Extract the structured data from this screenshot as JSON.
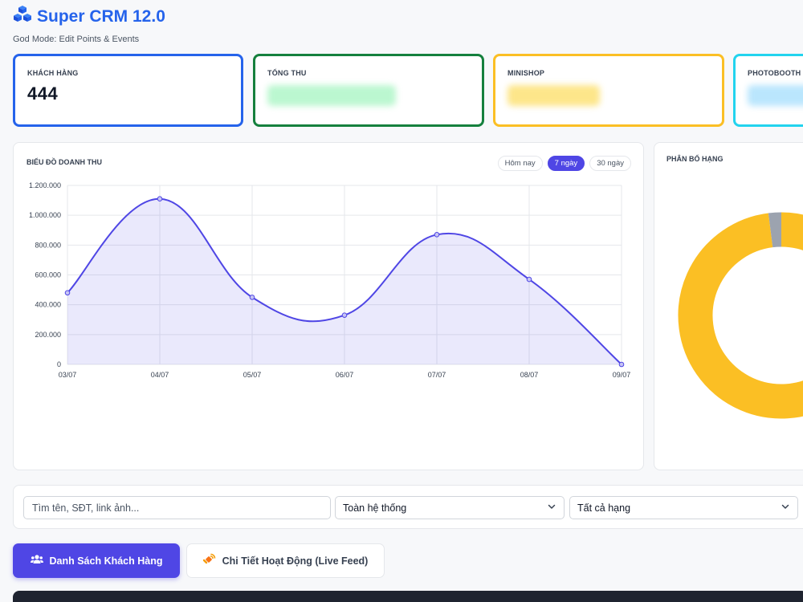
{
  "header": {
    "title": "Super CRM 12.0",
    "subtitle": "God Mode: Edit Points & Events"
  },
  "stats": [
    {
      "label": "KHÁCH HÀNG",
      "value": "444",
      "color": "#2563eb"
    },
    {
      "label": "TỔNG THU",
      "color": "#15803d"
    },
    {
      "label": "MINISHOP",
      "color": "#fbbf24"
    },
    {
      "label": "PHOTOBOOTH",
      "color": "#22d3ee"
    }
  ],
  "revenue_chart": {
    "title": "BIỂU ĐỒ DOANH THU",
    "ranges": [
      "Hôm nay",
      "7 ngày",
      "30 ngày"
    ],
    "active_range": "7 ngày"
  },
  "chart_data": [
    {
      "type": "area",
      "categories": [
        "03/07",
        "04/07",
        "05/07",
        "06/07",
        "07/07",
        "08/07",
        "09/07"
      ],
      "series": [
        {
          "values": [
            480000,
            1110000,
            450000,
            330000,
            870000,
            570000,
            0
          ]
        }
      ],
      "ylim": [
        0,
        1200000
      ],
      "yticks": [
        "0",
        "200.000",
        "400.000",
        "600.000",
        "800.000",
        "1.000.000",
        "1.200.000"
      ],
      "color": "#4f46e5",
      "grid": true
    },
    {
      "type": "pie",
      "title": "PHÂN BỔ HẠNG",
      "values": [
        98,
        2
      ],
      "colors": [
        "#fbbf24",
        "#9ca3af"
      ]
    }
  ],
  "filters": {
    "search_placeholder": "Tìm tên, SĐT, link ảnh...",
    "scope": "Toàn hệ thống",
    "rank": "Tất cả hạng"
  },
  "tabs": {
    "customers": "Danh Sách Khách Hàng",
    "live_feed": "Chi Tiết Hoạt Động (Live Feed)"
  },
  "colors": {
    "accent": "#4f46e5",
    "brand": "#2563eb"
  }
}
